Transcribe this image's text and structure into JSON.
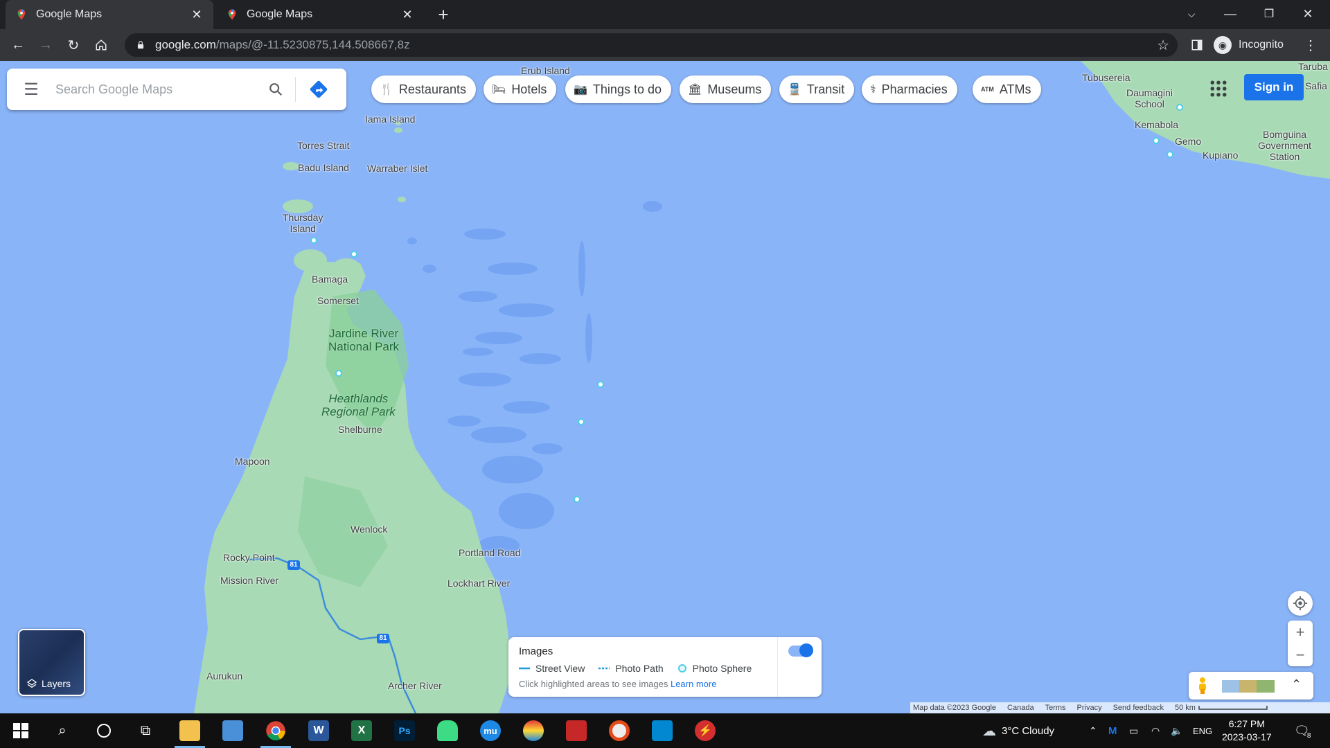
{
  "browser": {
    "tabs": [
      {
        "title": "Google Maps",
        "active": true
      },
      {
        "title": "Google Maps",
        "active": false
      }
    ],
    "url_host": "google.com",
    "url_path": "/maps/@-11.5230875,144.508667,8z",
    "profile_label": "Incognito"
  },
  "search": {
    "placeholder": "Search Google Maps"
  },
  "chips": [
    {
      "label": "Restaurants",
      "icon": "fork-knife-icon"
    },
    {
      "label": "Hotels",
      "icon": "bed-icon"
    },
    {
      "label": "Things to do",
      "icon": "camera-icon"
    },
    {
      "label": "Museums",
      "icon": "museum-icon"
    },
    {
      "label": "Transit",
      "icon": "train-icon"
    },
    {
      "label": "Pharmacies",
      "icon": "pharmacy-icon"
    },
    {
      "label": "ATMs",
      "icon": "atm-icon"
    }
  ],
  "signin_label": "Sign in",
  "places": {
    "erub": "Erub Island",
    "iama": "Iama Island",
    "torres": "Torres Strait",
    "badu": "Badu Island",
    "warraber": "Warraber Islet",
    "thursday1": "Thursday",
    "thursday2": "Island",
    "bamaga": "Bamaga",
    "somerset": "Somerset",
    "shelburne": "Shelburne",
    "mapoon": "Mapoon",
    "wenlock": "Wenlock",
    "portland": "Portland Road",
    "rocky": "Rocky Point",
    "mission": "Mission River",
    "lockhart": "Lockhart River",
    "aurukun": "Aurukun",
    "archer": "Archer River",
    "tubusereia": "Tubusereia",
    "daumagini1": "Daumagini",
    "daumagini2": "School",
    "kemabola": "Kemabola",
    "gemo": "Gemo",
    "kupiano": "Kupiano",
    "bomguina1": "Bomguina",
    "bomguina2": "Government",
    "bomguina3": "Station",
    "taruba": "Taruba",
    "safia": "Safia",
    "jardine1": "Jardine River",
    "jardine2": "National Park",
    "heath1": "Heathlands",
    "heath2": "Regional Park",
    "route": "81"
  },
  "layers_label": "Layers",
  "images_panel": {
    "title": "Images",
    "street_view": "Street View",
    "photo_path": "Photo Path",
    "photo_sphere": "Photo Sphere",
    "hint": "Click highlighted areas to see images",
    "learn_more": "Learn more",
    "toggle_on": true
  },
  "footer": {
    "map_data": "Map data ©2023 Google",
    "country": "Canada",
    "terms": "Terms",
    "privacy": "Privacy",
    "feedback": "Send feedback",
    "scale": "50 km"
  },
  "taskbar": {
    "weather": "3°C Cloudy",
    "lang": "ENG",
    "time": "6:27 PM",
    "date": "2023-03-17",
    "notifications": "8"
  },
  "colors": {
    "water": "#8ab4f8",
    "land": "#a8dab5",
    "accent": "#1a73e8"
  }
}
